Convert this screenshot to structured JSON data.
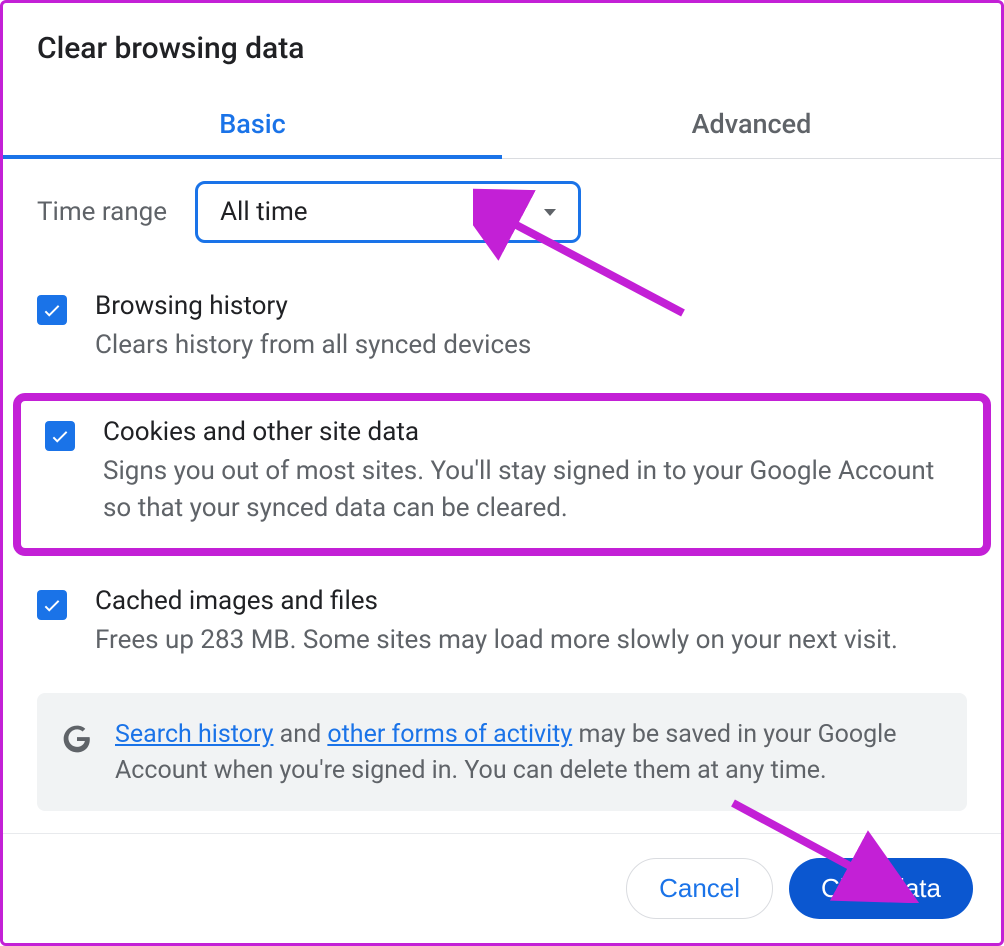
{
  "dialog": {
    "title": "Clear browsing data"
  },
  "tabs": {
    "basic": "Basic",
    "advanced": "Advanced"
  },
  "timeRange": {
    "label": "Time range",
    "value": "All time"
  },
  "options": {
    "browsingHistory": {
      "title": "Browsing history",
      "desc": "Clears history from all synced devices"
    },
    "cookies": {
      "title": "Cookies and other site data",
      "desc": "Signs you out of most sites. You'll stay signed in to your Google Account so that your synced data can be cleared."
    },
    "cache": {
      "title": "Cached images and files",
      "desc": "Frees up 283 MB. Some sites may load more slowly on your next visit."
    }
  },
  "infoBox": {
    "link1": "Search history",
    "textMid1": " and ",
    "link2": "other forms of activity",
    "textRest": " may be saved in your Google Account when you're signed in. You can delete them at any time."
  },
  "footer": {
    "cancel": "Cancel",
    "clear": "Clear data"
  },
  "annotations": {
    "color": "#c320d6"
  }
}
